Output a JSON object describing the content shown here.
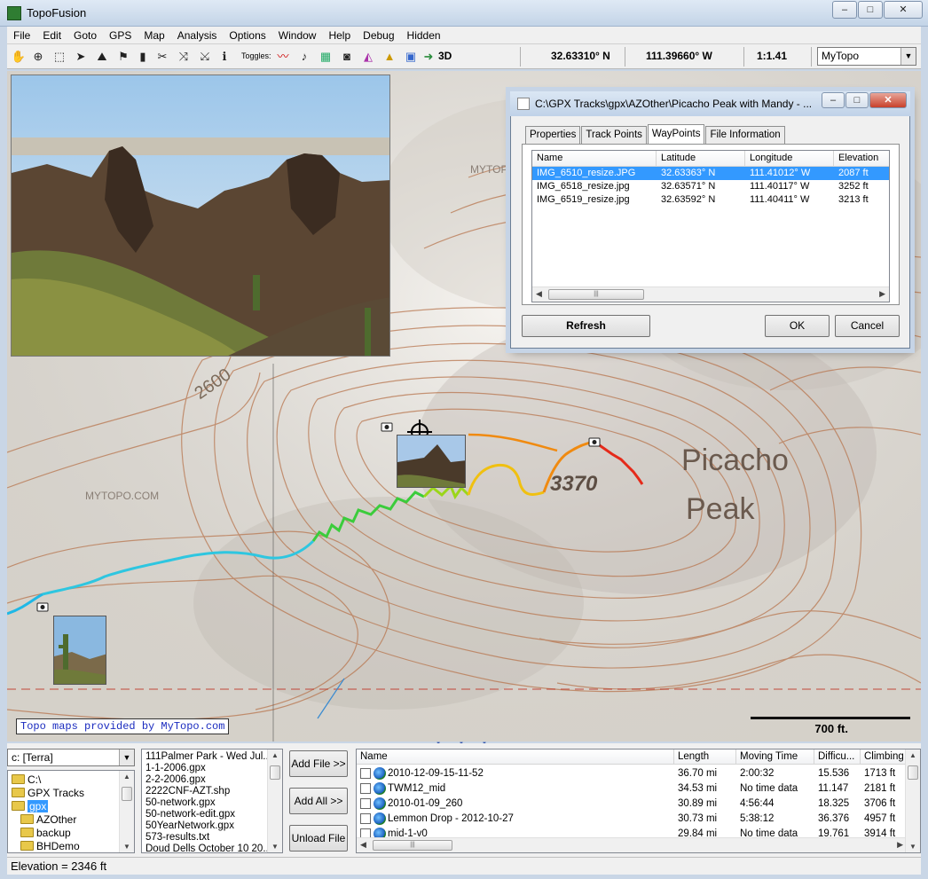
{
  "window": {
    "title": "TopoFusion",
    "min": "–",
    "max": "□",
    "close": "✕"
  },
  "menu": [
    "File",
    "Edit",
    "Goto",
    "GPS",
    "Map",
    "Analysis",
    "Options",
    "Window",
    "Help",
    "Debug",
    "Hidden"
  ],
  "toolbar": {
    "toggles_label": "Toggles:",
    "three_d": "3D",
    "latitude": "32.63310° N",
    "longitude": "111.39660° W",
    "zoom": "1:1.41",
    "map_type": "MyTopo",
    "icons": [
      "hand-icon",
      "zoom-icon",
      "select-icon",
      "pointer-icon",
      "measure-icon",
      "flag-icon",
      "waypoint-icon",
      "cut-icon",
      "join-icon",
      "merge-icon",
      "info-icon"
    ]
  },
  "map": {
    "credit": "Topo maps provided by MyTopo.com",
    "scale_label": "700 ft.",
    "labels": {
      "peak_name_1": "Picacho",
      "peak_name_2": "Peak",
      "elevation": "3370",
      "contour": "2600",
      "watermark": "MYTOPO.COM"
    }
  },
  "dialog": {
    "title": "C:\\GPX Tracks\\gpx\\AZOther\\Picacho Peak with Mandy - ...",
    "tabs": [
      "Properties",
      "Track Points",
      "WayPoints",
      "File Information"
    ],
    "active_tab": "WayPoints",
    "columns": [
      "Name",
      "Latitude",
      "Longitude",
      "Elevation"
    ],
    "rows": [
      {
        "name": "IMG_6510_resize.JPG",
        "lat": "32.63363° N",
        "lon": "111.41012° W",
        "ele": "2087 ft"
      },
      {
        "name": "IMG_6518_resize.jpg",
        "lat": "32.63571° N",
        "lon": "111.40117° W",
        "ele": "3252 ft"
      },
      {
        "name": "IMG_6519_resize.jpg",
        "lat": "32.63592° N",
        "lon": "111.40411° W",
        "ele": "3213 ft"
      }
    ],
    "refresh": "Refresh",
    "ok": "OK",
    "cancel": "Cancel"
  },
  "bottom": {
    "drive": "c: [Terra]",
    "tree": [
      {
        "label": "C:\\",
        "indent": 0,
        "selected": false
      },
      {
        "label": "GPX Tracks",
        "indent": 1,
        "selected": false
      },
      {
        "label": "gpx",
        "indent": 1,
        "selected": true
      },
      {
        "label": "AZOther",
        "indent": 2,
        "selected": false
      },
      {
        "label": "backup",
        "indent": 2,
        "selected": false
      },
      {
        "label": "BHDemo",
        "indent": 2,
        "selected": false
      }
    ],
    "files": [
      "111Palmer Park - Wed Jul...",
      "1-1-2006.gpx",
      "2-2-2006.gpx",
      "2222CNF-AZT.shp",
      "50-network.gpx",
      "50-network-edit.gpx",
      "50YearNetwork.gpx",
      "573-results.txt",
      "Doud Dells October 10 20..."
    ],
    "add_file": "Add File >>",
    "add_all": "Add All >>",
    "unload_file": "Unload File",
    "track_columns": [
      "Name",
      "Length",
      "Moving Time",
      "Difficu...",
      "Climbing"
    ],
    "tracks": [
      {
        "name": "2010-12-09-15-11-52",
        "length": "36.70 mi",
        "time": "2:00:32",
        "difficulty": "15.536",
        "climbing": "1713 ft",
        "globe": true
      },
      {
        "name": "TWM12_mid",
        "length": "34.53 mi",
        "time": "No time data",
        "difficulty": "11.147",
        "climbing": "2181 ft",
        "globe": true
      },
      {
        "name": "2010-01-09_260",
        "length": "30.89 mi",
        "time": "4:56:44",
        "difficulty": "18.325",
        "climbing": "3706 ft",
        "globe": true
      },
      {
        "name": "Lemmon Drop - 2012-10-27",
        "length": "30.73 mi",
        "time": "5:38:12",
        "difficulty": "36.376",
        "climbing": "4957 ft",
        "globe": true
      },
      {
        "name": "mid-1-v0",
        "length": "29.84 mi",
        "time": "No time data",
        "difficulty": "19.761",
        "climbing": "3914 ft",
        "globe": true
      }
    ]
  },
  "status": "Elevation = 2346 ft"
}
